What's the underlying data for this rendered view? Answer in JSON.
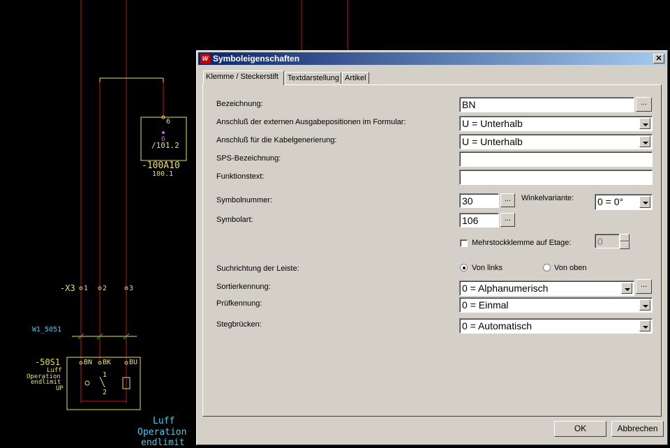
{
  "background": {
    "labels": {
      "terminal_6": "6",
      "terminal_6b": "6",
      "ref_101": "/101.2",
      "device_100A10": "-100A10",
      "ref_100_1": "100.1",
      "x3": "-X3",
      "x3_1": "1",
      "x3_2": "2",
      "x3_3": "3",
      "cable": "W1_5051",
      "device_50S1": "-50S1",
      "desc_1": "Luff",
      "desc_2": "Operation",
      "desc_3": "endlimit",
      "desc_4": "UP",
      "pin_bn": "BN",
      "pin_bk": "BK",
      "pin_bu": "BU",
      "pin_1": "1",
      "pin_2": "2",
      "bottom_1": "Luff",
      "bottom_2": "Operation",
      "bottom_3": "endlimit"
    }
  },
  "dialog": {
    "title": "Symboleigenschaften",
    "close_icon": "close-icon",
    "tabs": [
      "Klemme / Steckerstift",
      "Textdarstellung",
      "Artikel"
    ],
    "fields": {
      "bezeichnung_label": "Bezeichnung:",
      "bezeichnung_value": "BN",
      "anschluss_formular_label": "Anschluß der externen Ausgabepositionen im Formular:",
      "anschluss_formular_value": "U = Unterhalb",
      "anschluss_kabel_label": "Anschluß für die Kabelgenerierung:",
      "anschluss_kabel_value": "U = Unterhalb",
      "sps_label": "SPS-Bezeichnung:",
      "sps_value": "",
      "funktionstext_label": "Funktionstext:",
      "funktionstext_value": "",
      "symbolnummer_label": "Symbolnummer:",
      "symbolnummer_value": "30",
      "winkel_label": "Winkelvariante:",
      "winkel_value": "0 = 0°",
      "symbolart_label": "Symbolart:",
      "symbolart_value": "106",
      "mehrstock_label": "Mehrstockklemme auf Etage:",
      "mehrstock_value": "0",
      "suchrichtung_label": "Suchrichtung der Leiste:",
      "von_links": "Von links",
      "von_oben": "Von oben",
      "sortier_label": "Sortierkennung:",
      "sortier_value": "0 = Alphanumerisch",
      "pruef_label": "Prüfkennung:",
      "pruef_value": "0 = Einmal",
      "steg_label": "Stegbrücken:",
      "steg_value": "0 = Automatisch",
      "browse": "..."
    },
    "buttons": {
      "ok": "OK",
      "cancel": "Abbrechen"
    }
  },
  "colors": {
    "wire": "#c01818",
    "symbol": "#e8e060",
    "text_cyan": "#4fc8e8",
    "title_start": "#0a246a"
  }
}
